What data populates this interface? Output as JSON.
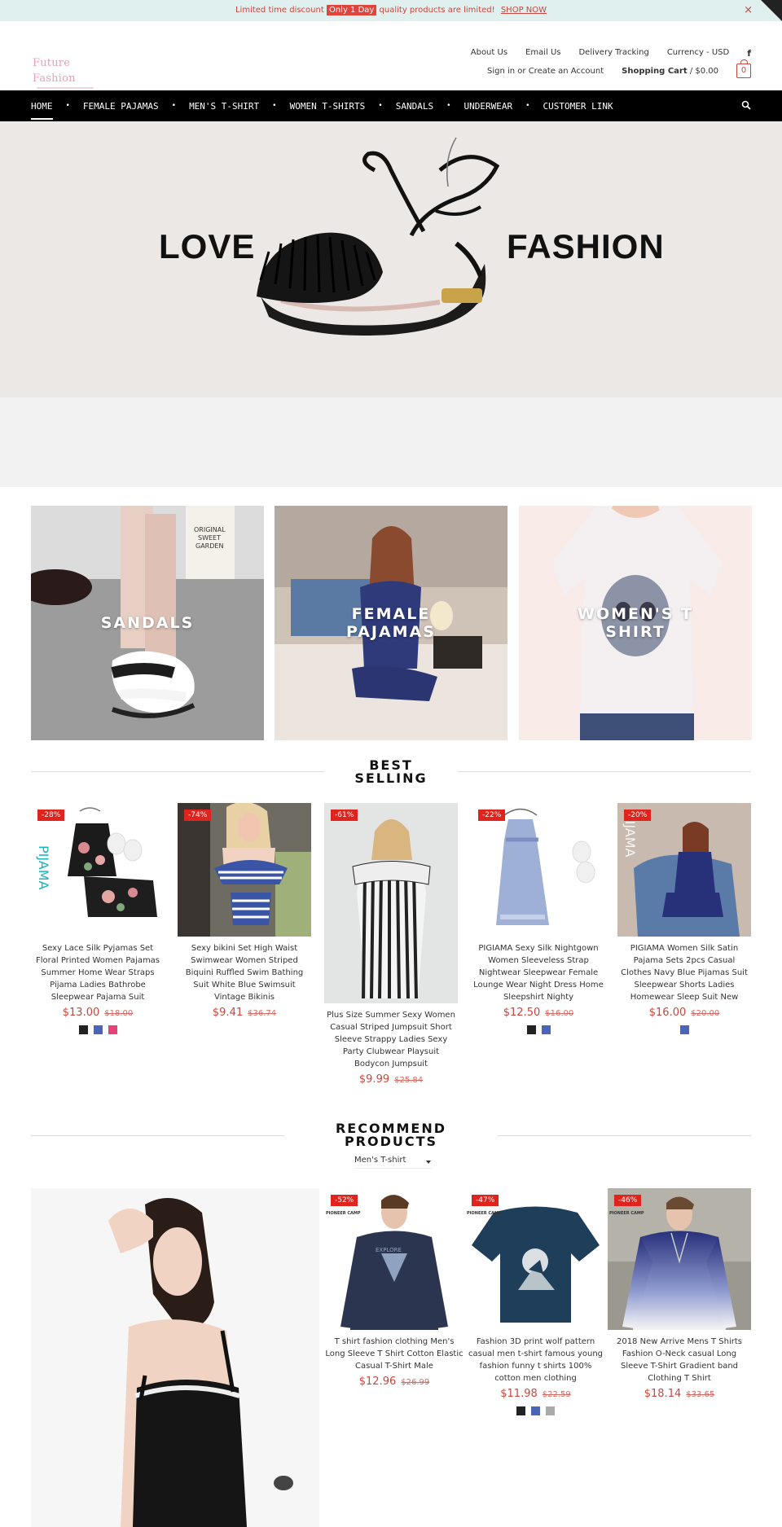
{
  "announcement": {
    "text_before": "Limited time discount",
    "highlight": "Only 1 Day",
    "text_after": "quality products are limited!",
    "shop_now": "SHOP NOW",
    "close": "×"
  },
  "header": {
    "logo_text": "Future Fashion",
    "links": [
      "About Us",
      "Email Us",
      "Delivery Tracking",
      "Currency - USD"
    ],
    "facebook": "f",
    "account": "Sign in or Create an Account",
    "cart_label": "Shopping Cart",
    "cart_total": "/ $0.00",
    "cart_count": "0"
  },
  "nav": {
    "items": [
      "HOME",
      "FEMALE PAJAMAS",
      "MEN'S T-SHIRT",
      "WOMEN T-SHIRTS",
      "SANDALS",
      "UNDERWEAR",
      "CUSTOMER LINK"
    ]
  },
  "hero": {
    "left_word": "LOVE",
    "right_word": "FASHION"
  },
  "categories": [
    {
      "label": "SANDALS"
    },
    {
      "label": "FEMALE PAJAMAS"
    },
    {
      "label": "WOMEN'S T SHIRT"
    }
  ],
  "best_selling": {
    "title_line1": "BEST",
    "title_line2": "SELLING",
    "products": [
      {
        "badge": "-28%",
        "title": "Sexy Lace Silk Pyjamas Set Floral Printed Women Pajamas Summer Home Wear Straps Pijama Ladies Bathrobe Sleepwear Pajama Suit",
        "price": "$13.00",
        "old": "$18.00",
        "swatches": [
          "#222222",
          "#4a64b8",
          "#e8407a"
        ]
      },
      {
        "badge": "-74%",
        "title": "Sexy bikini Set High Waist Swimwear Women Striped Biquini Ruffled Swim Bathing Suit White Blue Swimsuit Vintage Bikinis",
        "price": "$9.41",
        "old": "$36.74",
        "swatches": []
      },
      {
        "badge": "-61%",
        "title": "Plus Size Summer Sexy Women Casual Striped Jumpsuit Short Sleeve Strappy Ladies Sexy Party Clubwear Playsuit Bodycon Jumpsuit",
        "price": "$9.99",
        "old": "$25.84",
        "swatches": []
      },
      {
        "badge": "-22%",
        "title": "PIGIAMA Sexy Silk Nightgown Women Sleeveless Strap Nightwear Sleepwear Female Lounge Wear Night Dress Home Sleepshirt Nighty",
        "price": "$12.50",
        "old": "$16.00",
        "swatches": [
          "#222222",
          "#4a64b8"
        ]
      },
      {
        "badge": "-20%",
        "title": "PIGIAMA Women Silk Satin Pajama Sets 2pcs Casual Clothes Navy Blue Pijamas Suit Sleepwear Shorts Ladies Homewear Sleep Suit New",
        "price": "$16.00",
        "old": "$20.00",
        "swatches": [
          "#4a64b8"
        ]
      }
    ]
  },
  "recommend": {
    "title_line1": "RECOMMEND",
    "title_line2": "PRODUCTS",
    "select_value": "Men's T-shirt",
    "products": [
      {
        "badge": "-52%",
        "brand": "PIONEER CAMP",
        "title": "T shirt fashion clothing Men's Long Sleeve T Shirt Cotton Elastic Casual T-Shirt Male",
        "price": "$12.96",
        "old": "$26.99",
        "swatches": []
      },
      {
        "badge": "-47%",
        "brand": "PIONEER CAMP",
        "title": "Fashion 3D print wolf pattern casual men t-shirt famous young fashion funny t shirts 100% cotton men clothing",
        "price": "$11.98",
        "old": "$22.59",
        "swatches": [
          "#222222",
          "#4a64b8",
          "#aaaaaa"
        ]
      },
      {
        "badge": "-46%",
        "brand": "PIONEER CAMP",
        "title": "2018 New Arrive Mens T Shirts Fashion O-Neck casual Long Sleeve T-Shirt Gradient band Clothing T Shirt",
        "price": "$18.14",
        "old": "$33.65",
        "swatches": []
      }
    ]
  }
}
